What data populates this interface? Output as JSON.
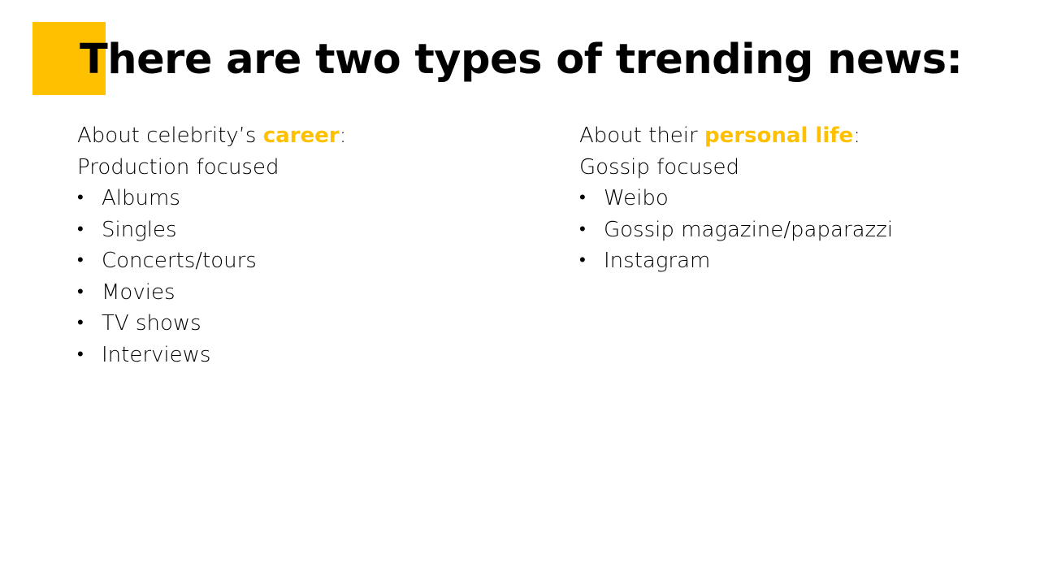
{
  "slide": {
    "title": "There are two types of trending news:",
    "accent_color": "#FFC000"
  },
  "left": {
    "heading_prefix": "About celebrity’s ",
    "heading_highlight": "career",
    "heading_suffix": ":",
    "subheading": "Production focused",
    "items": [
      "Albums",
      "Singles",
      "Concerts/tours",
      "Movies",
      "TV shows",
      "Interviews"
    ]
  },
  "right": {
    "heading_prefix": "About their ",
    "heading_highlight": "personal life",
    "heading_suffix": ":",
    "subheading": "Gossip focused",
    "items": [
      "Weibo",
      "Gossip magazine/paparazzi",
      "Instagram"
    ]
  },
  "bullet_glyph": "•"
}
